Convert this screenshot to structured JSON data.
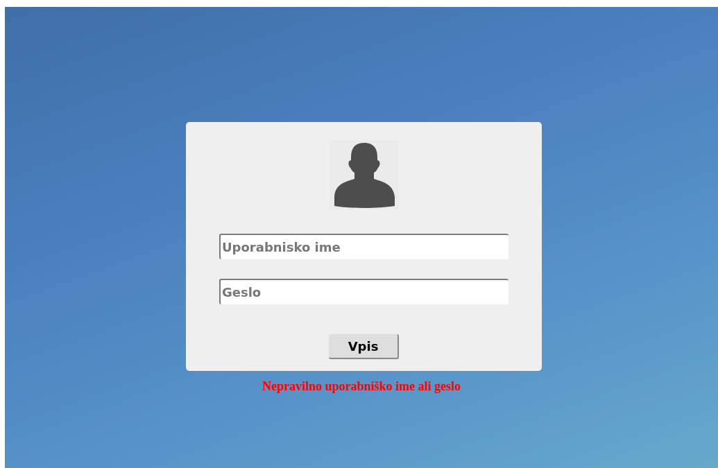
{
  "login_form": {
    "fields": [
      {
        "placeholder": "Uporabnisko ime"
      },
      {
        "placeholder": "Geslo"
      }
    ],
    "submit_button": "Vpis"
  },
  "error_message": "Nepravilno uporabniško ime ali geslo"
}
